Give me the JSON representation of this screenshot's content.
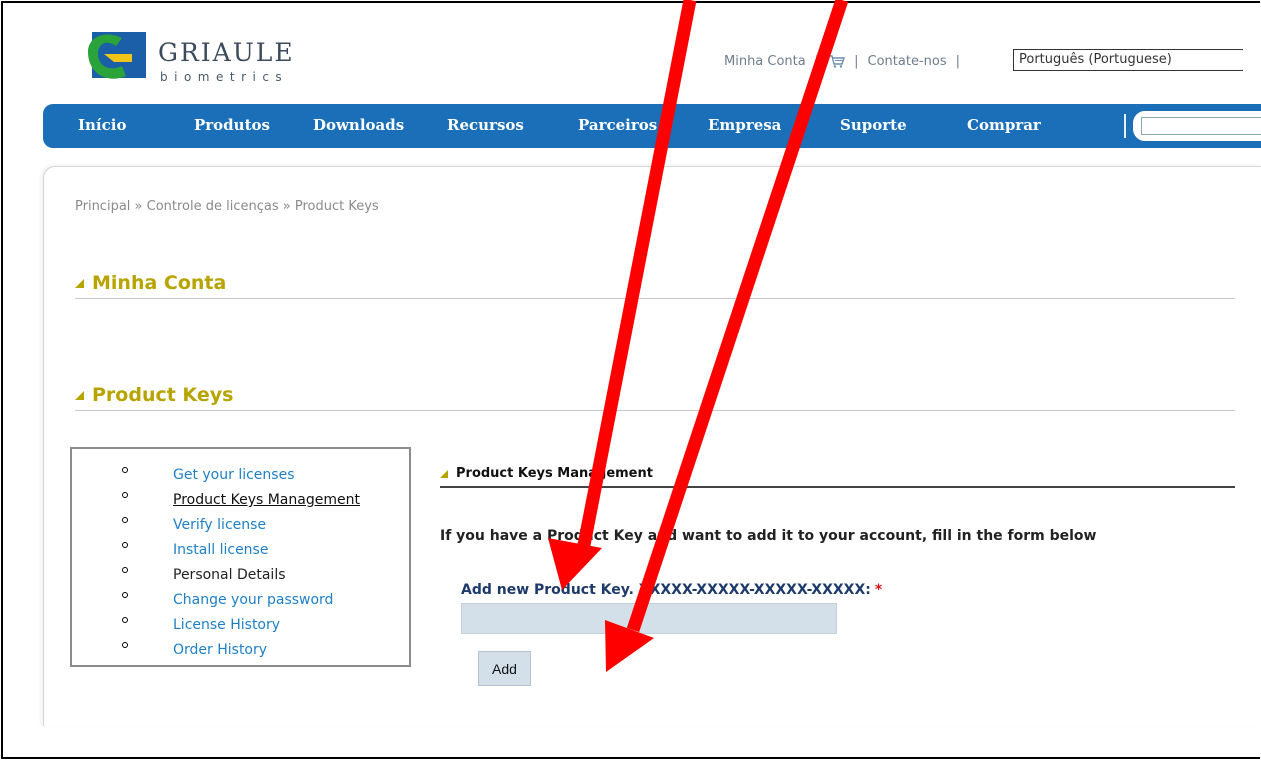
{
  "header": {
    "logo_name": "GRIAULE",
    "logo_sub": "biometrics",
    "links": {
      "account": "Minha Conta",
      "separator": "|",
      "contact": "Contate-nos"
    },
    "language_selected": "Português (Portuguese)"
  },
  "nav": {
    "items": [
      "Início",
      "Produtos",
      "Downloads",
      "Recursos",
      "Parceiros",
      "Empresa",
      "Suporte",
      "Comprar"
    ],
    "search_value": ""
  },
  "breadcrumb": "Principal » Controle de licenças » Product Keys",
  "sections": {
    "account_title": "Minha Conta",
    "product_keys_title": "Product Keys"
  },
  "side_menu": {
    "items": [
      "Get your licenses",
      "Product Keys Management",
      "Verify license",
      "Install license",
      "Personal Details",
      "Change your password",
      "License History",
      "Order History"
    ]
  },
  "panel": {
    "heading": "Product Keys Management",
    "intro": "If you have a Product Key and want to add it to your account, fill in the form below",
    "field_label": "Add new Product Key. XXXXX-XXXXX-XXXXX-XXXXX:",
    "required_mark": "*",
    "field_value": "",
    "button_label": "Add"
  },
  "colors": {
    "nav_blue": "#1a6fb8",
    "title_gold": "#b8a400",
    "link_blue": "#1f7fc6",
    "field_bg": "#d3e0ea",
    "annotation_red": "#ff0000"
  },
  "icons": [
    "griaule-logo-icon",
    "cart-icon",
    "triangle-marker-icon",
    "bullet-icon"
  ]
}
